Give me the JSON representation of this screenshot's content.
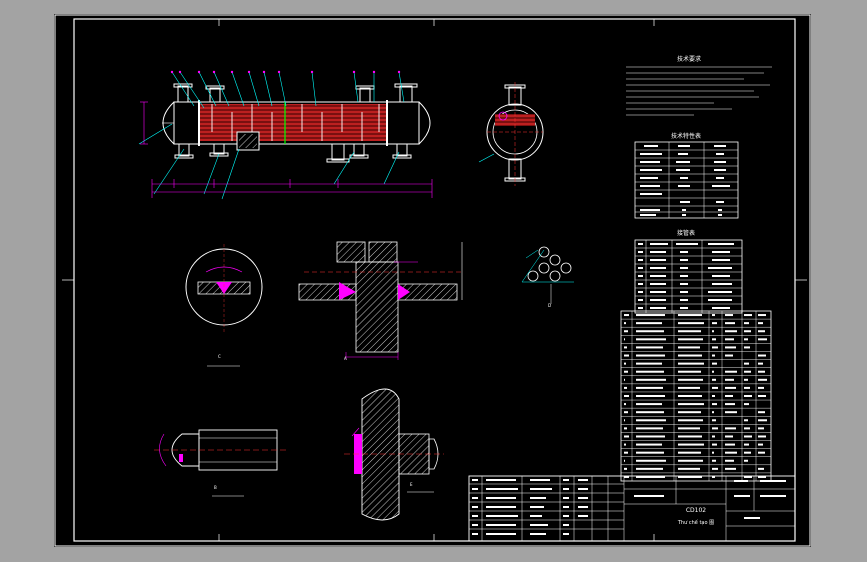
{
  "drawing": {
    "title_block": {
      "drawing_title": "CD102",
      "drawing_subtitle": "Thư chế tạo 图"
    },
    "notes_heading": "技术要求",
    "tech_table_heading": "技术特性表",
    "nozzle_table_heading": "接管表",
    "view_labels": {
      "detail_a": "A",
      "detail_b": "B",
      "detail_c": "C",
      "detail_d": "D",
      "detail_e": "E"
    },
    "colors": {
      "background": "#000000",
      "frame": "#ffffff",
      "tube_bundle": "#cc2222",
      "hatch": "#ffffff",
      "dimension": "#ff00ff",
      "leader": "#00ffff",
      "center_line": "#ff3333",
      "tube_sheet": "#00ff00"
    }
  }
}
